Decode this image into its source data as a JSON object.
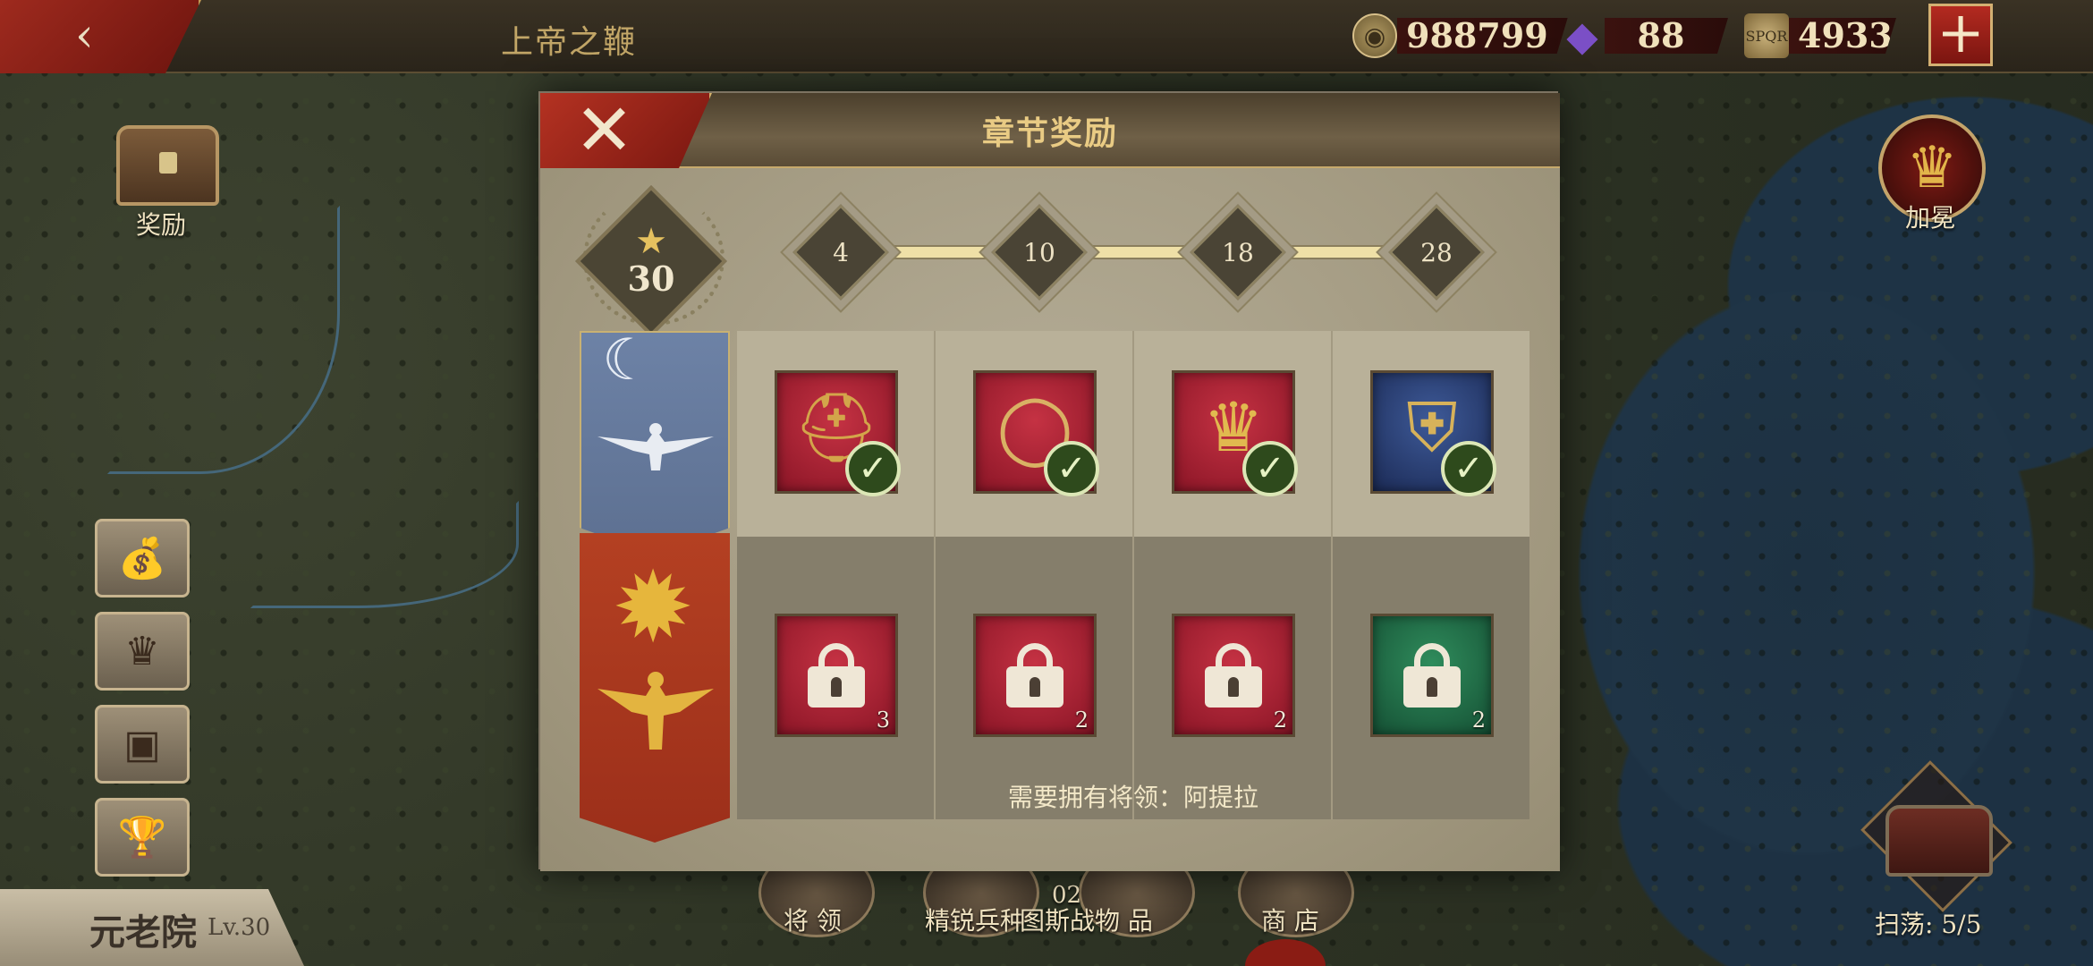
{
  "top_bar": {
    "title": "上帝之鞭",
    "resources": {
      "coins": "988799",
      "gems": "88",
      "spqr_label": "SPQR",
      "spqr": "4933"
    },
    "back_icon": "back-arrow-icon",
    "plus_label": "+"
  },
  "left_panel": {
    "rewards_label": "奖励",
    "senate": {
      "name": "元老院",
      "level": "Lv.30"
    }
  },
  "right_panel": {
    "crown_label": "加冕",
    "sweep_label": "扫荡: 5/5"
  },
  "bottom_tabs": {
    "generals": "将 领",
    "elite": "精锐兵种",
    "spoils": "图斯战物 品",
    "shop": "商 店",
    "spoils_badge": "02"
  },
  "dialog": {
    "title": "章节奖励",
    "close_label": "✕",
    "stars": "30",
    "milestones": [
      "4",
      "10",
      "18",
      "28"
    ],
    "free_rewards": [
      {
        "item": "helmet",
        "claimed": true
      },
      {
        "item": "ring",
        "claimed": true
      },
      {
        "item": "crown",
        "claimed": true
      },
      {
        "item": "shield",
        "claimed": true
      }
    ],
    "premium_rewards": [
      {
        "item": "helmet",
        "locked": true,
        "qty": "3"
      },
      {
        "item": "ring",
        "locked": true,
        "qty": "2"
      },
      {
        "item": "crown",
        "locked": true,
        "qty": "2"
      },
      {
        "item": "armor-pieces",
        "locked": true,
        "qty": "2"
      }
    ],
    "requirement": "需要拥有将领：阿提拉"
  },
  "colors": {
    "accent_red": "#9e2a1e",
    "gold": "#c9a55f",
    "panel": "#a49b85",
    "check_green": "#2e4a1c"
  }
}
